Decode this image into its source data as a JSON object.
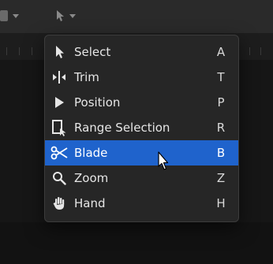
{
  "menu": {
    "items": [
      {
        "label": "Select",
        "shortcut": "A",
        "icon": "arrow-pointer-icon",
        "selected": false
      },
      {
        "label": "Trim",
        "shortcut": "T",
        "icon": "trim-icon",
        "selected": false
      },
      {
        "label": "Position",
        "shortcut": "P",
        "icon": "position-icon",
        "selected": false
      },
      {
        "label": "Range Selection",
        "shortcut": "R",
        "icon": "range-selection-icon",
        "selected": false
      },
      {
        "label": "Blade",
        "shortcut": "B",
        "icon": "blade-icon",
        "selected": true
      },
      {
        "label": "Zoom",
        "shortcut": "Z",
        "icon": "magnifier-icon",
        "selected": false
      },
      {
        "label": "Hand",
        "shortcut": "H",
        "icon": "hand-icon",
        "selected": false
      }
    ]
  },
  "colors": {
    "menu_background": "#262626",
    "selection": "#1f63cc",
    "text": "#e6e6e6",
    "toolbar": "#2a2a2a"
  }
}
